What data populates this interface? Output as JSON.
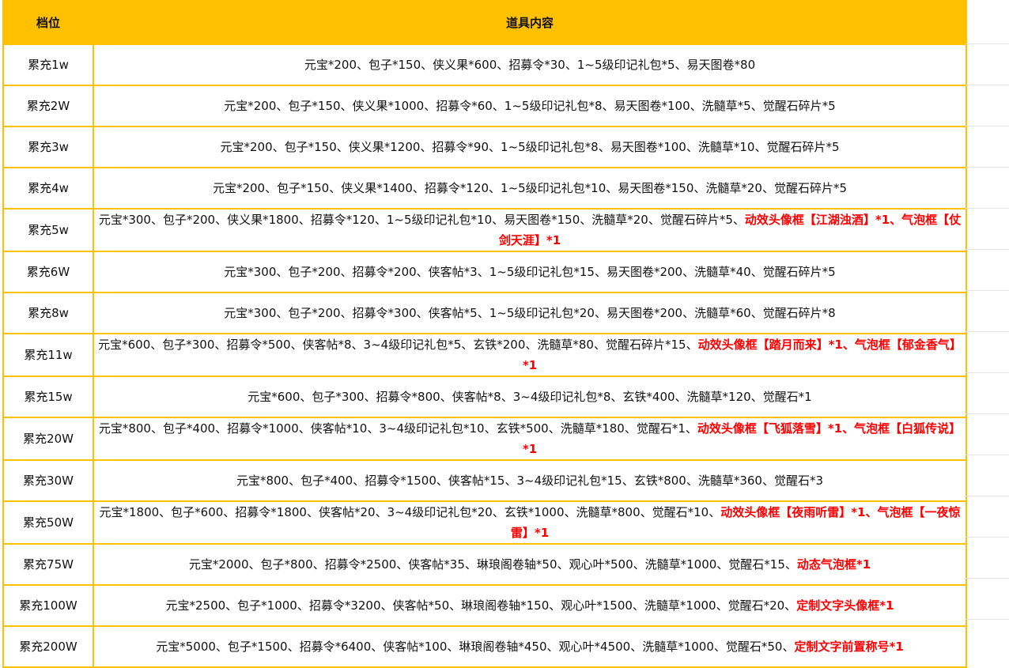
{
  "header": {
    "tier": "档位",
    "content": "道具内容"
  },
  "rows": [
    {
      "tier": "累充1w",
      "plain": "元宝*200、包子*150、侠义果*600、招募令*30、1~5级印记礼包*5、易天图卷*80",
      "highlight": ""
    },
    {
      "tier": "累充2W",
      "plain": "元宝*200、包子*150、侠义果*1000、招募令*60、1~5级印记礼包*8、易天图卷*100、洗髓草*5、觉醒石碎片*5",
      "highlight": ""
    },
    {
      "tier": "累充3w",
      "plain": "元宝*200、包子*150、侠义果*1200、招募令*90、1~5级印记礼包*8、易天图卷*100、洗髓草*10、觉醒石碎片*5",
      "highlight": ""
    },
    {
      "tier": "累充4w",
      "plain": "元宝*200、包子*150、侠义果*1400、招募令*120、1~5级印记礼包*10、易天图卷*150、洗髓草*20、觉醒石碎片*5",
      "highlight": ""
    },
    {
      "tier": "累充5w",
      "plain": "元宝*300、包子*200、侠义果*1800、招募令*120、1~5级印记礼包*10、易天图卷*150、洗髓草*20、觉醒石碎片*5、",
      "highlight": "动效头像框【江湖浊酒】*1、气泡框【仗剑天涯】*1"
    },
    {
      "tier": "累充6W",
      "plain": "元宝*300、包子*200、招募令*200、侠客帖*3、1~5级印记礼包*15、易天图卷*200、洗髓草*40、觉醒石碎片*5",
      "highlight": ""
    },
    {
      "tier": "累充8w",
      "plain": "元宝*300、包子*200、招募令*300、侠客帖*5、1~5级印记礼包*20、易天图卷*200、洗髓草*60、觉醒石碎片*8",
      "highlight": ""
    },
    {
      "tier": "累充11w",
      "plain": "元宝*600、包子*300、招募令*500、侠客帖*8、3~4级印记礼包*5、玄铁*200、洗髓草*80、觉醒石碎片*15、",
      "highlight": "动效头像框【踏月而来】*1、气泡框【郁金香气】*1"
    },
    {
      "tier": "累充15w",
      "plain": "元宝*600、包子*300、招募令*800、侠客帖*8、3~4级印记礼包*8、玄铁*400、洗髓草*120、觉醒石*1",
      "highlight": ""
    },
    {
      "tier": "累充20W",
      "plain": "元宝*800、包子*400、招募令*1000、侠客帖*10、3~4级印记礼包*10、玄铁*500、洗髓草*180、觉醒石*1、",
      "highlight": "动效头像框【飞狐落雪】*1、气泡框【白狐传说】*1"
    },
    {
      "tier": "累充30W",
      "plain": "元宝*800、包子*400、招募令*1500、侠客帖*15、3~4级印记礼包*15、玄铁*800、洗髓草*360、觉醒石*3",
      "highlight": ""
    },
    {
      "tier": "累充50W",
      "plain": "元宝*1800、包子*600、招募令*1800、侠客帖*20、3~4级印记礼包*20、玄铁*1000、洗髓草*800、觉醒石*10、",
      "highlight": "动效头像框【夜雨听雷】*1、气泡框【一夜惊雷】*1"
    },
    {
      "tier": "累充75W",
      "plain": "元宝*2000、包子*800、招募令*2500、侠客帖*35、琳琅阁卷轴*50、观心叶*500、洗髓草*1000、觉醒石*15、",
      "highlight": "动态气泡框*1"
    },
    {
      "tier": "累充100W",
      "plain": "元宝*2500、包子*1000、招募令*3200、侠客帖*50、琳琅阁卷轴*150、观心叶*1500、洗髓草*1000、觉醒石*20、",
      "highlight": "定制文字头像框*1"
    },
    {
      "tier": "累充200W",
      "plain": "元宝*5000、包子*1500、招募令*6400、侠客帖*100、琳琅阁卷轴*450、观心叶*4500、洗髓草*1000、觉醒石*50、",
      "highlight": "定制文字前置称号*1"
    }
  ],
  "colors": {
    "header_bg": "#ffc000",
    "border": "#ffc000",
    "highlight_text": "#ff0000"
  }
}
